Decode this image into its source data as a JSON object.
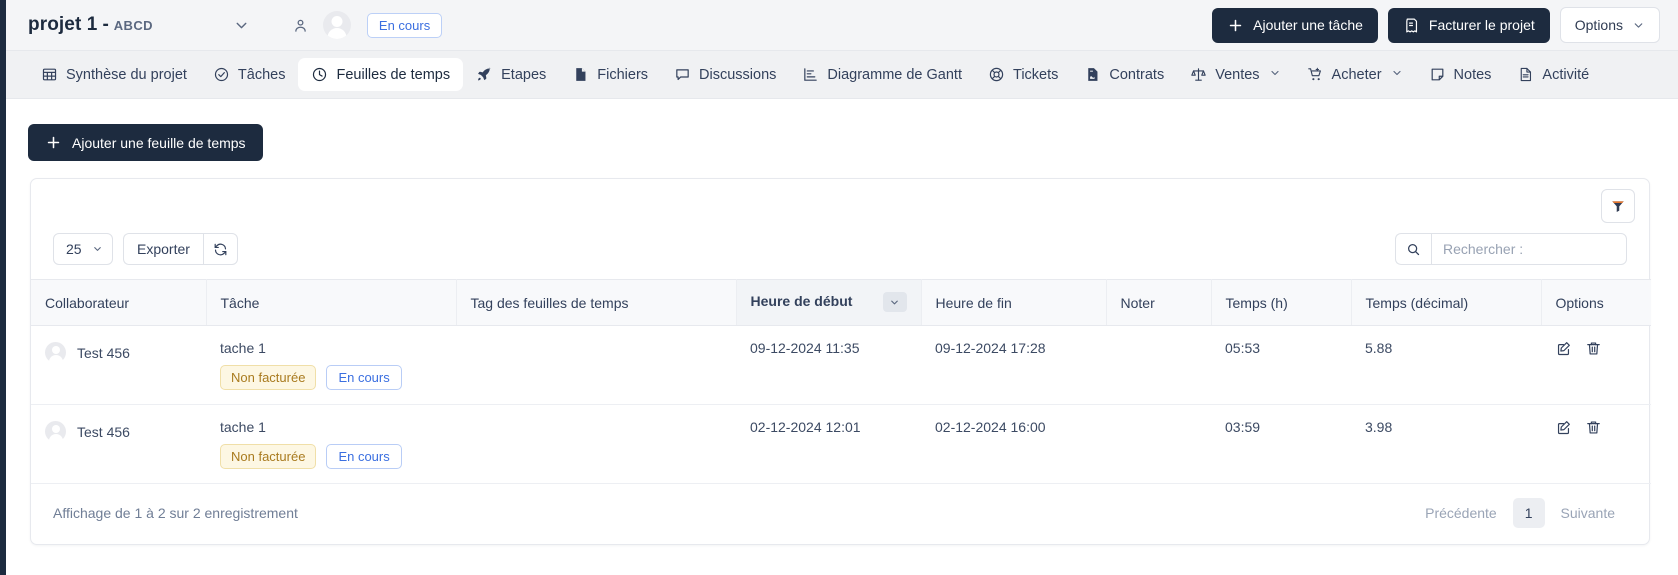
{
  "header": {
    "project_title": "projet 1",
    "separator": "-",
    "project_code": "ABCD",
    "status_badge": "En cours",
    "add_task_label": "Ajouter une tâche",
    "invoice_label": "Facturer le projet",
    "options_label": "Options"
  },
  "tabs": [
    {
      "label": "Synthèse du projet",
      "icon": "grid-icon",
      "active": false,
      "caret": false
    },
    {
      "label": "Tâches",
      "icon": "check-circle-icon",
      "active": false,
      "caret": false
    },
    {
      "label": "Feuilles de temps",
      "icon": "clock-icon",
      "active": true,
      "caret": false
    },
    {
      "label": "Etapes",
      "icon": "rocket-icon",
      "active": false,
      "caret": false
    },
    {
      "label": "Fichiers",
      "icon": "file-icon",
      "active": false,
      "caret": false
    },
    {
      "label": "Discussions",
      "icon": "chat-icon",
      "active": false,
      "caret": false
    },
    {
      "label": "Diagramme de Gantt",
      "icon": "gantt-icon",
      "active": false,
      "caret": false
    },
    {
      "label": "Tickets",
      "icon": "lifebuoy-icon",
      "active": false,
      "caret": false
    },
    {
      "label": "Contrats",
      "icon": "contract-icon",
      "active": false,
      "caret": false
    },
    {
      "label": "Ventes",
      "icon": "scales-icon",
      "active": false,
      "caret": true
    },
    {
      "label": "Acheter",
      "icon": "cart-icon",
      "active": false,
      "caret": true
    },
    {
      "label": "Notes",
      "icon": "note-icon",
      "active": false,
      "caret": false
    },
    {
      "label": "Activité",
      "icon": "activity-file-icon",
      "active": false,
      "caret": false
    }
  ],
  "actions": {
    "add_timesheet_label": "Ajouter une feuille de temps"
  },
  "toolbar": {
    "page_length_value": "25",
    "page_length_options": [
      "25"
    ],
    "export_label": "Exporter",
    "refresh_icon": "refresh-icon",
    "filter_icon": "funnel-icon",
    "search_icon": "search-icon",
    "search_value": "",
    "search_placeholder": "Rechercher :"
  },
  "table": {
    "columns": [
      {
        "label": "Collaborateur",
        "sorted": false
      },
      {
        "label": "Tâche",
        "sorted": false
      },
      {
        "label": "Tag des feuilles de temps",
        "sorted": false
      },
      {
        "label": "Heure de début",
        "sorted": true
      },
      {
        "label": "Heure de fin",
        "sorted": false
      },
      {
        "label": "Noter",
        "sorted": false
      },
      {
        "label": "Temps (h)",
        "sorted": false
      },
      {
        "label": "Temps (décimal)",
        "sorted": false
      },
      {
        "label": "Options",
        "sorted": false
      }
    ],
    "rows": [
      {
        "collaborator": "Test 456",
        "task": "tache 1",
        "tag_billing": "Non facturée",
        "tag_status": "En cours",
        "timesheet_tag": "",
        "start": "09-12-2024 11:35",
        "end": "09-12-2024 17:28",
        "note": "",
        "time_h": "05:53",
        "time_decimal": "5.88"
      },
      {
        "collaborator": "Test 456",
        "task": "tache 1",
        "tag_billing": "Non facturée",
        "tag_status": "En cours",
        "timesheet_tag": "",
        "start": "02-12-2024 12:01",
        "end": "02-12-2024 16:00",
        "note": "",
        "time_h": "03:59",
        "time_decimal": "3.98"
      }
    ]
  },
  "footer": {
    "info": "Affichage de 1 à 2 sur 2 enregistrement",
    "prev_label": "Précédente",
    "page_number": "1",
    "next_label": "Suivante"
  },
  "colors": {
    "dark": "#1d2b3f",
    "accent_blue": "#3b6fe0",
    "warn_amber": "#a97b1f",
    "funnel_orange": "#e8762c"
  }
}
